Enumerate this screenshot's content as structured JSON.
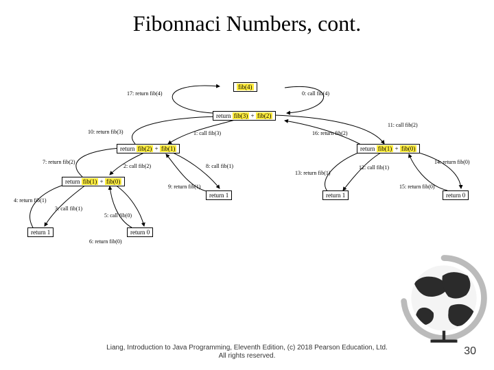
{
  "title": "Fibonnaci Numbers, cont.",
  "footer_line1": "Liang, Introduction to Java Programming, Eleventh Edition, (c) 2018 Pearson Education, Ltd.",
  "footer_line2": "All rights reserved.",
  "page_number": "30",
  "nodes": {
    "fib4": {
      "plain": "",
      "hl1": "fib(4)",
      "mid": "",
      "hl2": "",
      "tail": ""
    },
    "ret32": {
      "plain": "return ",
      "hl1": "fib(3)",
      "mid": " + ",
      "hl2": "fib(2)",
      "tail": ""
    },
    "ret21": {
      "plain": "return ",
      "hl1": "fib(2)",
      "mid": " + ",
      "hl2": "fib(1)",
      "tail": ""
    },
    "ret10_left": {
      "plain": "return ",
      "hl1": "fib(1)",
      "mid": " + ",
      "hl2": "fib(0)",
      "tail": ""
    },
    "ret1_a": {
      "plain": "return 1",
      "hl1": "",
      "mid": "",
      "hl2": "",
      "tail": ""
    },
    "ret0_a": {
      "plain": "return 0",
      "hl1": "",
      "mid": "",
      "hl2": "",
      "tail": ""
    },
    "ret1_b": {
      "plain": "return 1",
      "hl1": "",
      "mid": "",
      "hl2": "",
      "tail": ""
    },
    "ret10_right": {
      "plain": "return ",
      "hl1": "fib(1)",
      "mid": " + ",
      "hl2": "fib(0)",
      "tail": ""
    },
    "ret1_c": {
      "plain": "return 1",
      "hl1": "",
      "mid": "",
      "hl2": "",
      "tail": ""
    },
    "ret0_b": {
      "plain": "return 0",
      "hl1": "",
      "mid": "",
      "hl2": "",
      "tail": ""
    }
  },
  "steps": {
    "s0": "call fib(4)",
    "s1": "call fib(3)",
    "s2": "call fib(2)",
    "s3": "call fib(1)",
    "s4": "return fib(1)",
    "s5": "call fib(0)",
    "s6": "return fib(0)",
    "s7": "return fib(2)",
    "s8": "call fib(1)",
    "s9": "return fib(1)",
    "s10": "return fib(3)",
    "s11": "call fib(2)",
    "s12": "call fib(1)",
    "s13": "return fib(1)",
    "s14": "return fib(0)",
    "s15": "return fib(0)",
    "s16": "return fib(2)",
    "s17": "return fib(4)"
  }
}
